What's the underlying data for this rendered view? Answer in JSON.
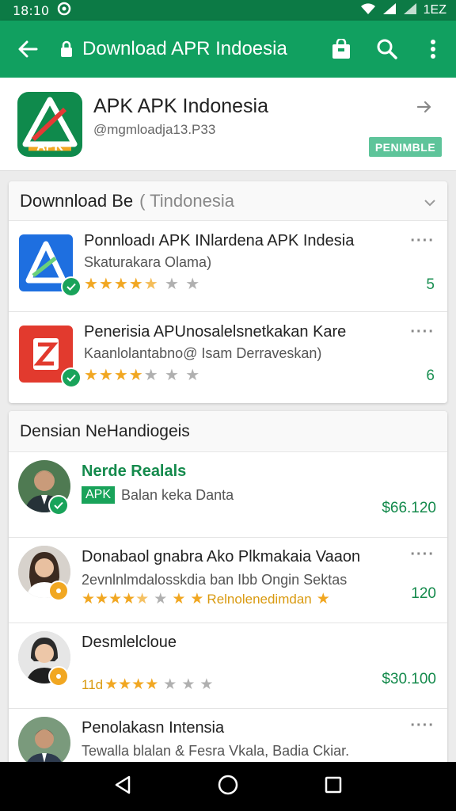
{
  "status": {
    "time": "18:10",
    "battery_text": "1EZ"
  },
  "toolbar": {
    "title": "Download APR Indoesia"
  },
  "app": {
    "name": "APK APK Indonesia",
    "handle": "@mgmloadja13.P33",
    "badge": "PENIMBLE",
    "colors": {
      "brand": "#11a060",
      "brand_dark": "#0c7a45"
    }
  },
  "downloads": {
    "header_main": "Downnload Be",
    "header_sub": "( Tindonesia",
    "items": [
      {
        "title": "Ponnloadı APK INlardena APK Indesia",
        "subtitle": "Skaturakara Olama)",
        "rating": 4.5,
        "count": "5",
        "icon": "blue-app-icon"
      },
      {
        "title": "Penerisia APUnosalelsnetkakan Kare",
        "subtitle": "Kaanlolantabno@ Isam Derraveskan)",
        "rating": 4,
        "count": "6",
        "icon": "red-app-icon"
      }
    ]
  },
  "developers": {
    "header": "Densian NeHandiogeis",
    "items": [
      {
        "name": "Nerde Realals",
        "tag": "APK",
        "subtitle": "Balan keka Danta",
        "price": "$66.120",
        "badge_color": "#19a35a"
      },
      {
        "name": "Donabaol gnabra Ako Plkmakaia Vaaon",
        "subtitle": "2evnlnlmdalosskdia ban Ibb Ongin Sektas",
        "stars_tag": "Relnolenedimdan",
        "price": "120",
        "badge_color": "#f1a722"
      },
      {
        "name": "Desmlelcloue",
        "stars_prefix": "11d",
        "price": "$30.100",
        "badge_color": "#f1a722"
      },
      {
        "name": "Penolakasn Intensia",
        "subtitle": "Tewalla blalan & Fesra Vkala, Badia Ckiar."
      }
    ]
  }
}
